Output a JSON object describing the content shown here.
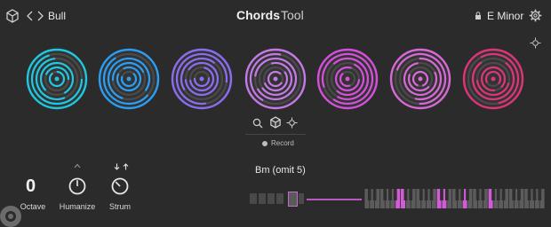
{
  "header": {
    "preset_name": "Bull",
    "title_bold": "Chords",
    "title_light": "Tool",
    "key_label": "E Minor"
  },
  "chords": {
    "circles": [
      {
        "color": "#1ec8e0"
      },
      {
        "color": "#2a9df4"
      },
      {
        "color": "#8c6cf0"
      },
      {
        "color": "#c47ae6"
      },
      {
        "color": "#d64fdc"
      },
      {
        "color": "#d868d8"
      },
      {
        "color": "#e0337a"
      }
    ]
  },
  "toolbar": {
    "record_label": "Record"
  },
  "controls": {
    "octave_value": "0",
    "octave_label": "Octave",
    "humanize_label": "Humanize",
    "strum_label": "Strum"
  },
  "chord_display": {
    "name": "Bm (omit 5)"
  },
  "colors": {
    "background": "#2b2b2b",
    "highlight_key": "#d25bd8",
    "text": "#e6e6e6"
  }
}
